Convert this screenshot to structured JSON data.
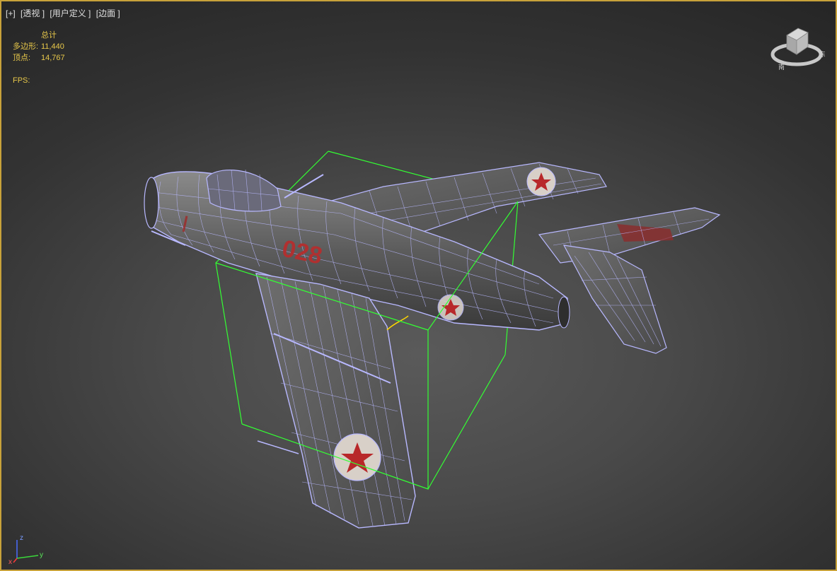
{
  "viewport": {
    "label_parts": [
      "[+]",
      "[透视 ]",
      "[用户定义 ]",
      "[边面 ]"
    ]
  },
  "stats": {
    "header": "总计",
    "polygons_label": "多边形:",
    "polygons_value": "11,440",
    "vertices_label": "顶点:",
    "vertices_value": "14,767",
    "fps_label": "FPS:"
  },
  "aircraft": {
    "fuselage_number": "028",
    "insignia": "red-star-roundel"
  },
  "axis": {
    "z": "z",
    "y": "y",
    "x": "x"
  },
  "colors": {
    "selection_box": "#33ff33",
    "wireframe": "#b8b8ff",
    "viewport_border": "#c8a23a",
    "stats_text": "#e8c84a"
  }
}
